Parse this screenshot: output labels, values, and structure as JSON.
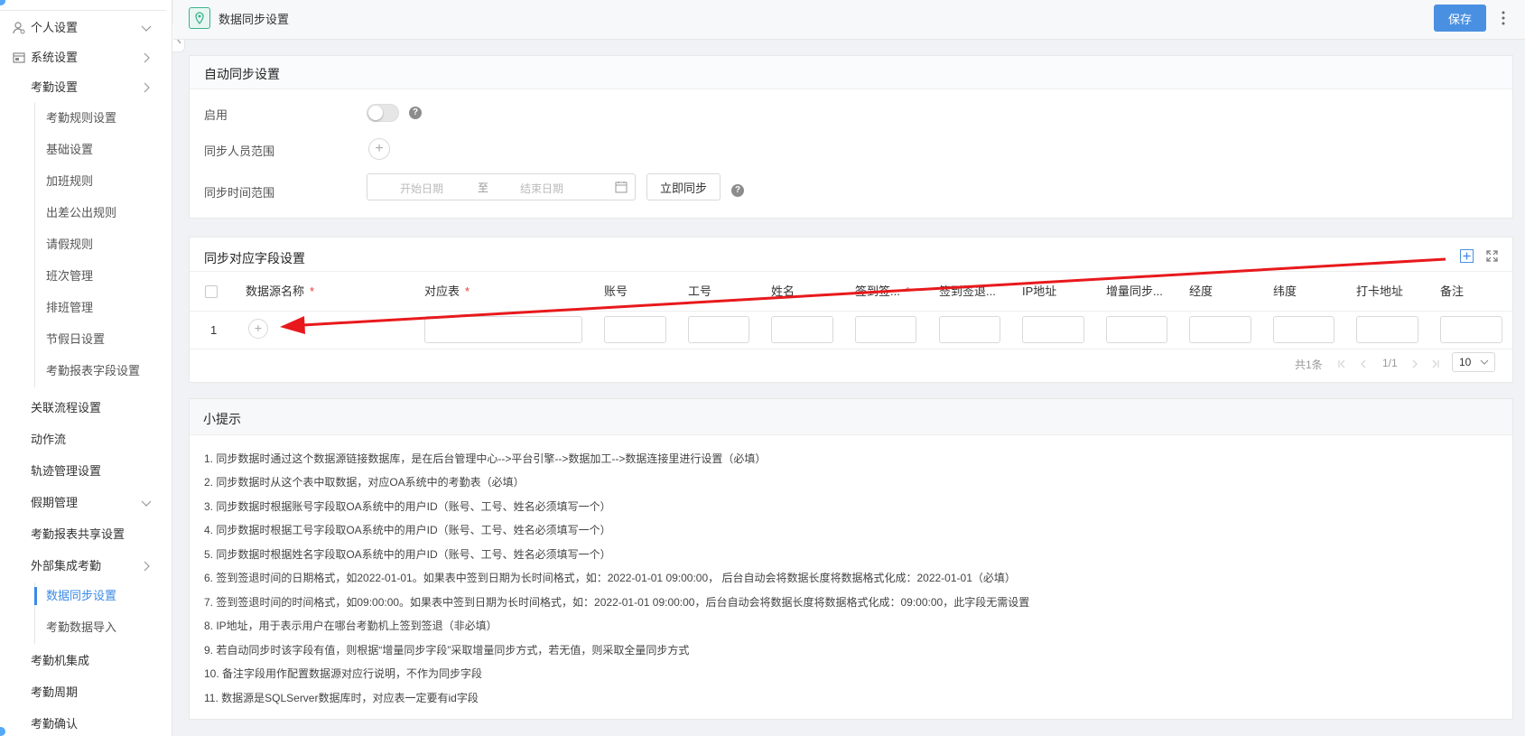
{
  "sidebar": {
    "items": [
      {
        "label": "个人设置"
      },
      {
        "label": "系统设置"
      },
      {
        "label": "考勤设置"
      },
      {
        "label": "考勤规则设置"
      },
      {
        "label": "基础设置"
      },
      {
        "label": "加班规则"
      },
      {
        "label": "出差公出规则"
      },
      {
        "label": "请假规则"
      },
      {
        "label": "班次管理"
      },
      {
        "label": "排班管理"
      },
      {
        "label": "节假日设置"
      },
      {
        "label": "考勤报表字段设置"
      },
      {
        "label": "关联流程设置"
      },
      {
        "label": "动作流"
      },
      {
        "label": "轨迹管理设置"
      },
      {
        "label": "假期管理"
      },
      {
        "label": "考勤报表共享设置"
      },
      {
        "label": "外部集成考勤"
      },
      {
        "label": "数据同步设置"
      },
      {
        "label": "考勤数据导入"
      },
      {
        "label": "考勤机集成"
      },
      {
        "label": "考勤周期"
      },
      {
        "label": "考勤确认"
      }
    ],
    "active_color": "#3b8ae6"
  },
  "header": {
    "title": "数据同步设置",
    "save_label": "保存",
    "accent": "#4a90e2",
    "icon": "location-pin-icon"
  },
  "auto_sync": {
    "title": "自动同步设置",
    "enable_label": "启用",
    "enabled": false,
    "range_label": "同步人员范围",
    "time_label": "同步时间范围",
    "start_placeholder": "开始日期",
    "to": "至",
    "end_placeholder": "结束日期",
    "sync_now": "立即同步",
    "help": "?"
  },
  "field_map": {
    "title": "同步对应字段设置",
    "columns": [
      "数据源名称",
      "对应表",
      "账号",
      "工号",
      "姓名",
      "签到签...",
      "签到签退...",
      "IP地址",
      "增量同步...",
      "经度",
      "纬度",
      "打卡地址",
      "备注"
    ],
    "required": "*",
    "rows": [
      {
        "index": "1"
      }
    ],
    "pager": {
      "total": "共1条",
      "page": "1/1",
      "page_size": "10"
    }
  },
  "tips": {
    "title": "小提示",
    "lines": [
      "1. 同步数据时通过这个数据源链接数据库，是在后台管理中心-->平台引擎-->数据加工-->数据连接里进行设置（必填）",
      "2. 同步数据时从这个表中取数据，对应OA系统中的考勤表（必填）",
      "3. 同步数据时根据账号字段取OA系统中的用户ID（账号、工号、姓名必须填写一个）",
      "4. 同步数据时根据工号字段取OA系统中的用户ID（账号、工号、姓名必须填写一个）",
      "5. 同步数据时根据姓名字段取OA系统中的用户ID（账号、工号、姓名必须填写一个）",
      "6. 签到签退时间的日期格式，如2022-01-01。如果表中签到日期为长时间格式，如：2022-01-01 09:00:00， 后台自动会将数据长度将数据格式化成：2022-01-01（必填）",
      "7. 签到签退时间的时间格式，如09:00:00。如果表中签到日期为长时间格式，如：2022-01-01 09:00:00，后台自动会将数据长度将数据格式化成：09:00:00，此字段无需设置",
      "8. IP地址，用于表示用户在哪台考勤机上签到签退（非必填）",
      "9. 若自动同步时该字段有值，则根据“增量同步字段”采取增量同步方式，若无值，则采取全量同步方式",
      "10. 备注字段用作配置数据源对应行说明，不作为同步字段",
      "11. 数据源是SQLServer数据库时，对应表一定要有id字段"
    ]
  },
  "annotation": {
    "arrow_color": "#e8191c"
  }
}
